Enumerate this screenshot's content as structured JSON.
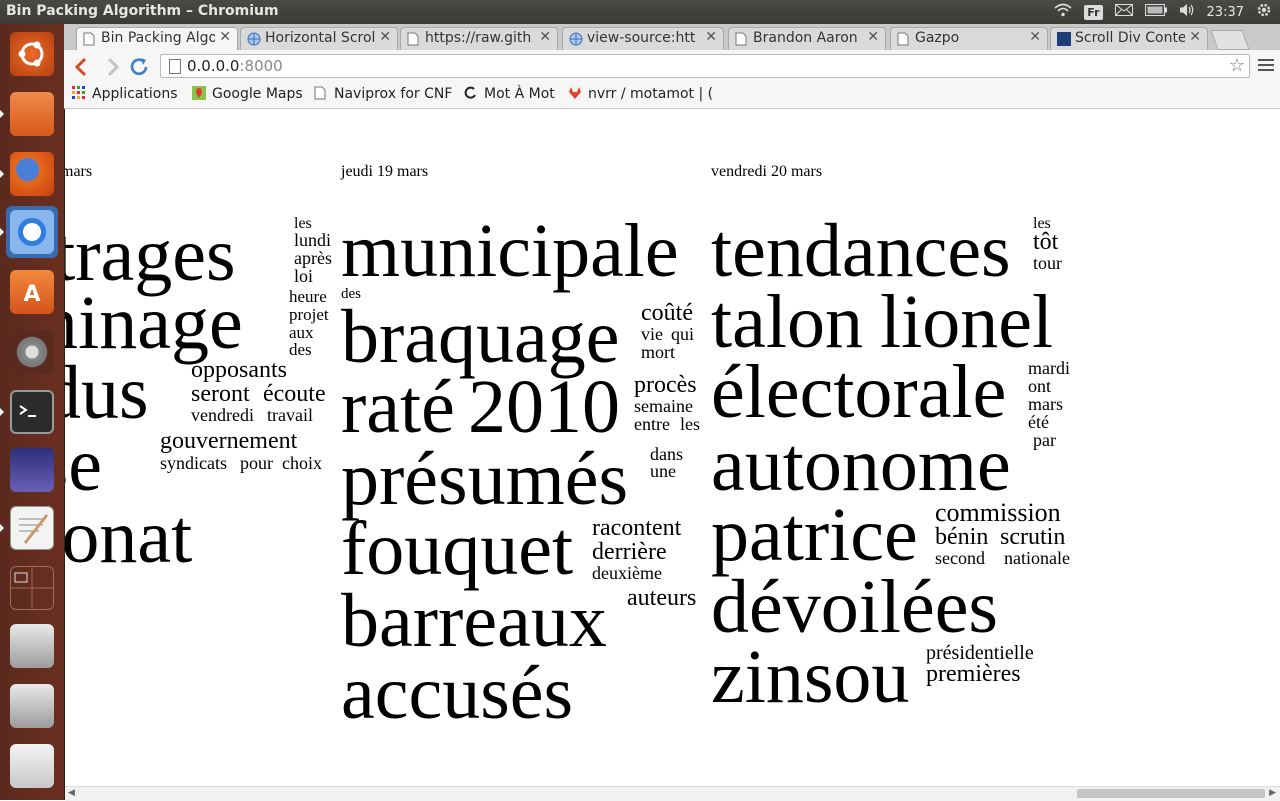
{
  "window": {
    "title": "Bin Packing Algorithm – Chromium"
  },
  "system_tray": {
    "keyboard": "Fr",
    "clock": "23:37"
  },
  "tabs": [
    {
      "label": "Bin Packing Algo",
      "active": true
    },
    {
      "label": "Horizontal Scrol"
    },
    {
      "label": "https://raw.gith"
    },
    {
      "label": "view-source:htt"
    },
    {
      "label": "Brandon Aaron"
    },
    {
      "label": "Gazpo"
    },
    {
      "label": "Scroll Div Conte"
    }
  ],
  "toolbar": {
    "url_host": "0.0.0.0",
    "url_port": ":8000"
  },
  "bookmarks": [
    {
      "label": "Applications",
      "icon": "apps-grid-icon"
    },
    {
      "label": "Google Maps",
      "icon": "maps-pin-icon"
    },
    {
      "label": "Naviprox for CNF",
      "icon": "page-icon"
    },
    {
      "label": "Mot À Mot",
      "icon": "mot-a-mot-icon"
    },
    {
      "label": "nvrr / motamot | (",
      "icon": "gitlab-icon"
    }
  ],
  "launcher": [
    "ubuntu-dash-icon",
    "files-icon",
    "firefox-icon",
    "chromium-icon",
    "software-center-icon",
    "system-settings-icon",
    "terminal-icon",
    "stellarium-icon",
    "text-editor-icon",
    "workspace-switcher-icon",
    "drive-icon",
    "drive-icon",
    "trash-icon"
  ],
  "columns": [
    {
      "heading": "mars",
      "words": [
        "bitrages",
        "les",
        "lundi",
        "après",
        "loi",
        "heure",
        "projet",
        "aux",
        "des",
        "minage",
        "ndus",
        "opposants",
        "seront",
        "écoute",
        "vendredi",
        "travail",
        "ase",
        "gouvernement",
        "syndicats",
        "pour",
        "choix",
        "tronat"
      ]
    },
    {
      "heading": "jeudi 19 mars",
      "words": [
        "municipale",
        "des",
        "braquage",
        "coûté",
        "vie",
        "qui",
        "mort",
        "raté",
        "2010",
        "procès",
        "semaine",
        "entre",
        "les",
        "présumés",
        "dans",
        "une",
        "fouquet",
        "racontent",
        "derrière",
        "deuxième",
        "barreaux",
        "auteurs",
        "accusés"
      ]
    },
    {
      "heading": "vendredi 20 mars",
      "words": [
        "tendances",
        "les",
        "tôt",
        "tour",
        "talon",
        "lionel",
        "électorale",
        "mardi",
        "ont",
        "mars",
        "été",
        "par",
        "autonome",
        "patrice",
        "commission",
        "bénin",
        "scrutin",
        "second",
        "nationale",
        "dévoilées",
        "zinsou",
        "présidentielle",
        "premières"
      ]
    }
  ]
}
